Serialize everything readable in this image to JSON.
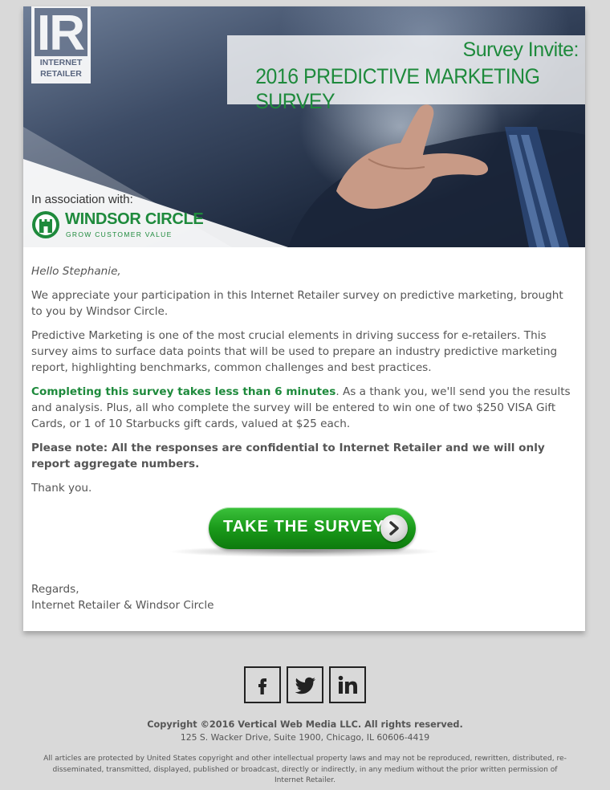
{
  "header": {
    "logo_line1": "INTERNET",
    "logo_line2": "RETAILER",
    "logo_mark": "IR",
    "survey_invite": "Survey Invite:",
    "survey_title": "2016 PREDICTIVE MARKETING SURVEY",
    "association": "In association with:",
    "partner_name": "WINDSOR CIRCLE",
    "partner_tagline": "GROW CUSTOMER VALUE"
  },
  "body": {
    "greeting": "Hello Stephanie,",
    "para1": "We appreciate your participation in this Internet Retailer survey on predictive marketing, brought to you by Windsor Circle.",
    "para2": "Predictive Marketing is one of the most crucial elements in driving success for e-retailers. This survey aims to surface data points that will be used to prepare an industry predictive marketing report, highlighting benchmarks, common challenges and best practices.",
    "para3_highlight": "Completing this survey takes less than 6 minutes",
    "para3_rest": ". As a thank you, we'll send you the results and analysis. Plus, all who complete the survey will be entered to win one of two $250 VISA Gift Cards, or 1 of 10 Starbucks gift cards, valued at $25 each.",
    "note": "Please note: All the responses are confidential to Internet Retailer and we will only report aggregate numbers.",
    "thanks": "Thank you.",
    "cta_label": "TAKE THE SURVEY",
    "regards": "Regards,",
    "signature": "Internet Retailer & Windsor Circle"
  },
  "footer": {
    "social_icons": [
      "facebook-icon",
      "twitter-icon",
      "linkedin-icon"
    ],
    "copyright": "Copyright ©2016 Vertical Web Media LLC. All rights reserved.",
    "address": "125 S. Wacker Drive, Suite 1900, Chicago, IL 60606-4419",
    "legal": "All articles are protected by United States copyright and other intellectual property laws and may not be reproduced, rewritten, distributed, re-disseminated, transmitted, displayed, published or broadcast, directly or indirectly, in any medium without the prior written permission of Internet Retailer."
  },
  "colors": {
    "brand_green": "#1e8a3c",
    "page_background": "#d9d9d9",
    "cta_green": "#1a9a1a"
  }
}
